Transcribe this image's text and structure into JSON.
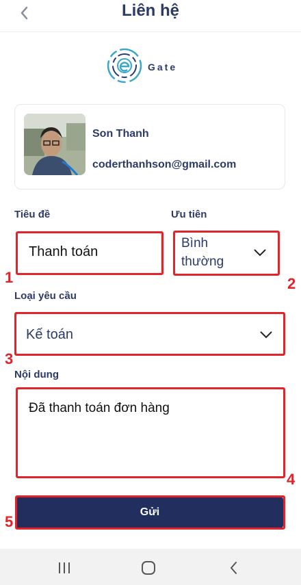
{
  "header": {
    "title": "Liên hệ"
  },
  "logo": {
    "text": "Gate"
  },
  "user": {
    "name": "Son Thanh",
    "email": "coderthanhson@gmail.com"
  },
  "form": {
    "subject_label": "Tiêu đề",
    "subject_value": "Thanh toán",
    "priority_label": "Ưu tiên",
    "priority_value_line1": "Bình",
    "priority_value_line2": "thường",
    "type_label": "Loại yêu cầu",
    "type_value": "Kế toán",
    "content_label": "Nội dung",
    "content_value": "Đã thanh toán đơn hàng",
    "submit_label": "Gửi"
  },
  "annotations": {
    "n1": "1",
    "n2": "2",
    "n3": "3",
    "n4": "4",
    "n5": "5"
  },
  "colors": {
    "primary": "#2b3a67",
    "button": "#222f5e",
    "highlight": "#e2232a"
  },
  "icons": {
    "back": "chevron-left-icon",
    "dropdown": "chevron-down-icon",
    "nav_recent": "recent-apps-icon",
    "nav_home": "home-icon",
    "nav_back": "back-icon"
  }
}
